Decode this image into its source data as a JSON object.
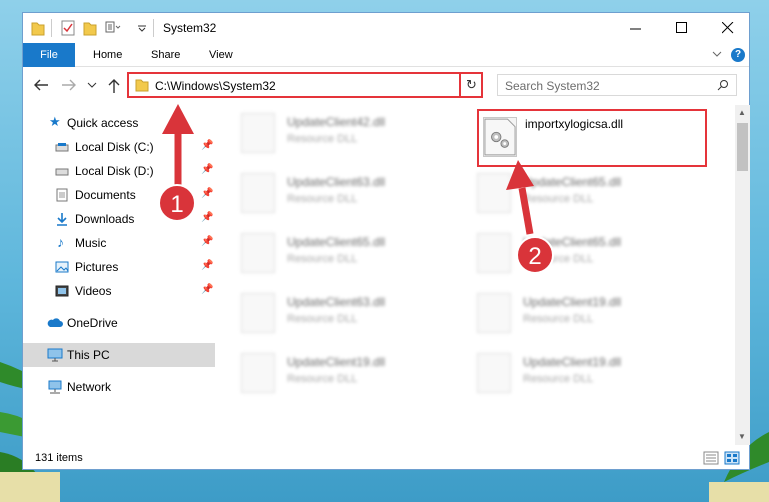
{
  "window": {
    "title": "System32",
    "ribbon_tabs": [
      "File",
      "Home",
      "Share",
      "View"
    ]
  },
  "address": {
    "path": "C:\\Windows\\System32",
    "search_placeholder": "Search System32"
  },
  "nav": {
    "quick_access": "Quick access",
    "items": [
      {
        "label": "Local Disk (C:)",
        "icon": "drive-icon",
        "pinned": true
      },
      {
        "label": "Local Disk (D:)",
        "icon": "drive-icon",
        "pinned": true
      },
      {
        "label": "Documents",
        "icon": "documents-icon",
        "pinned": true
      },
      {
        "label": "Downloads",
        "icon": "downloads-icon",
        "pinned": true
      },
      {
        "label": "Music",
        "icon": "music-icon",
        "pinned": true
      },
      {
        "label": "Pictures",
        "icon": "pictures-icon",
        "pinned": true
      },
      {
        "label": "Videos",
        "icon": "videos-icon",
        "pinned": true
      }
    ],
    "onedrive": "OneDrive",
    "this_pc": "This PC",
    "network": "Network"
  },
  "files": {
    "left": [
      {
        "name": "UpdateClient42.dll",
        "type": "Resource DLL"
      },
      {
        "name": "UpdateClient63.dll",
        "type": "Resource DLL"
      },
      {
        "name": "UpdateClient65.dll",
        "type": "Resource DLL"
      },
      {
        "name": "UpdateClient63.dll",
        "type": "Resource DLL"
      },
      {
        "name": "UpdateClient19.dll",
        "type": "Resource DLL"
      }
    ],
    "highlighted": {
      "name": "importxylogicsa.dll"
    },
    "right": [
      {
        "name": "UpdateClient65.dll",
        "type": "Resource DLL"
      },
      {
        "name": "UpdateClient65.dll",
        "type": "Resource DLL"
      },
      {
        "name": "UpdateClient19.dll",
        "type": "Resource DLL"
      },
      {
        "name": "UpdateClient19.dll",
        "type": "Resource DLL"
      }
    ]
  },
  "status": {
    "item_count": "131 items"
  },
  "callouts": {
    "one": "1",
    "two": "2"
  },
  "colors": {
    "accent": "#1979ca",
    "highlight": "#e5343a"
  }
}
